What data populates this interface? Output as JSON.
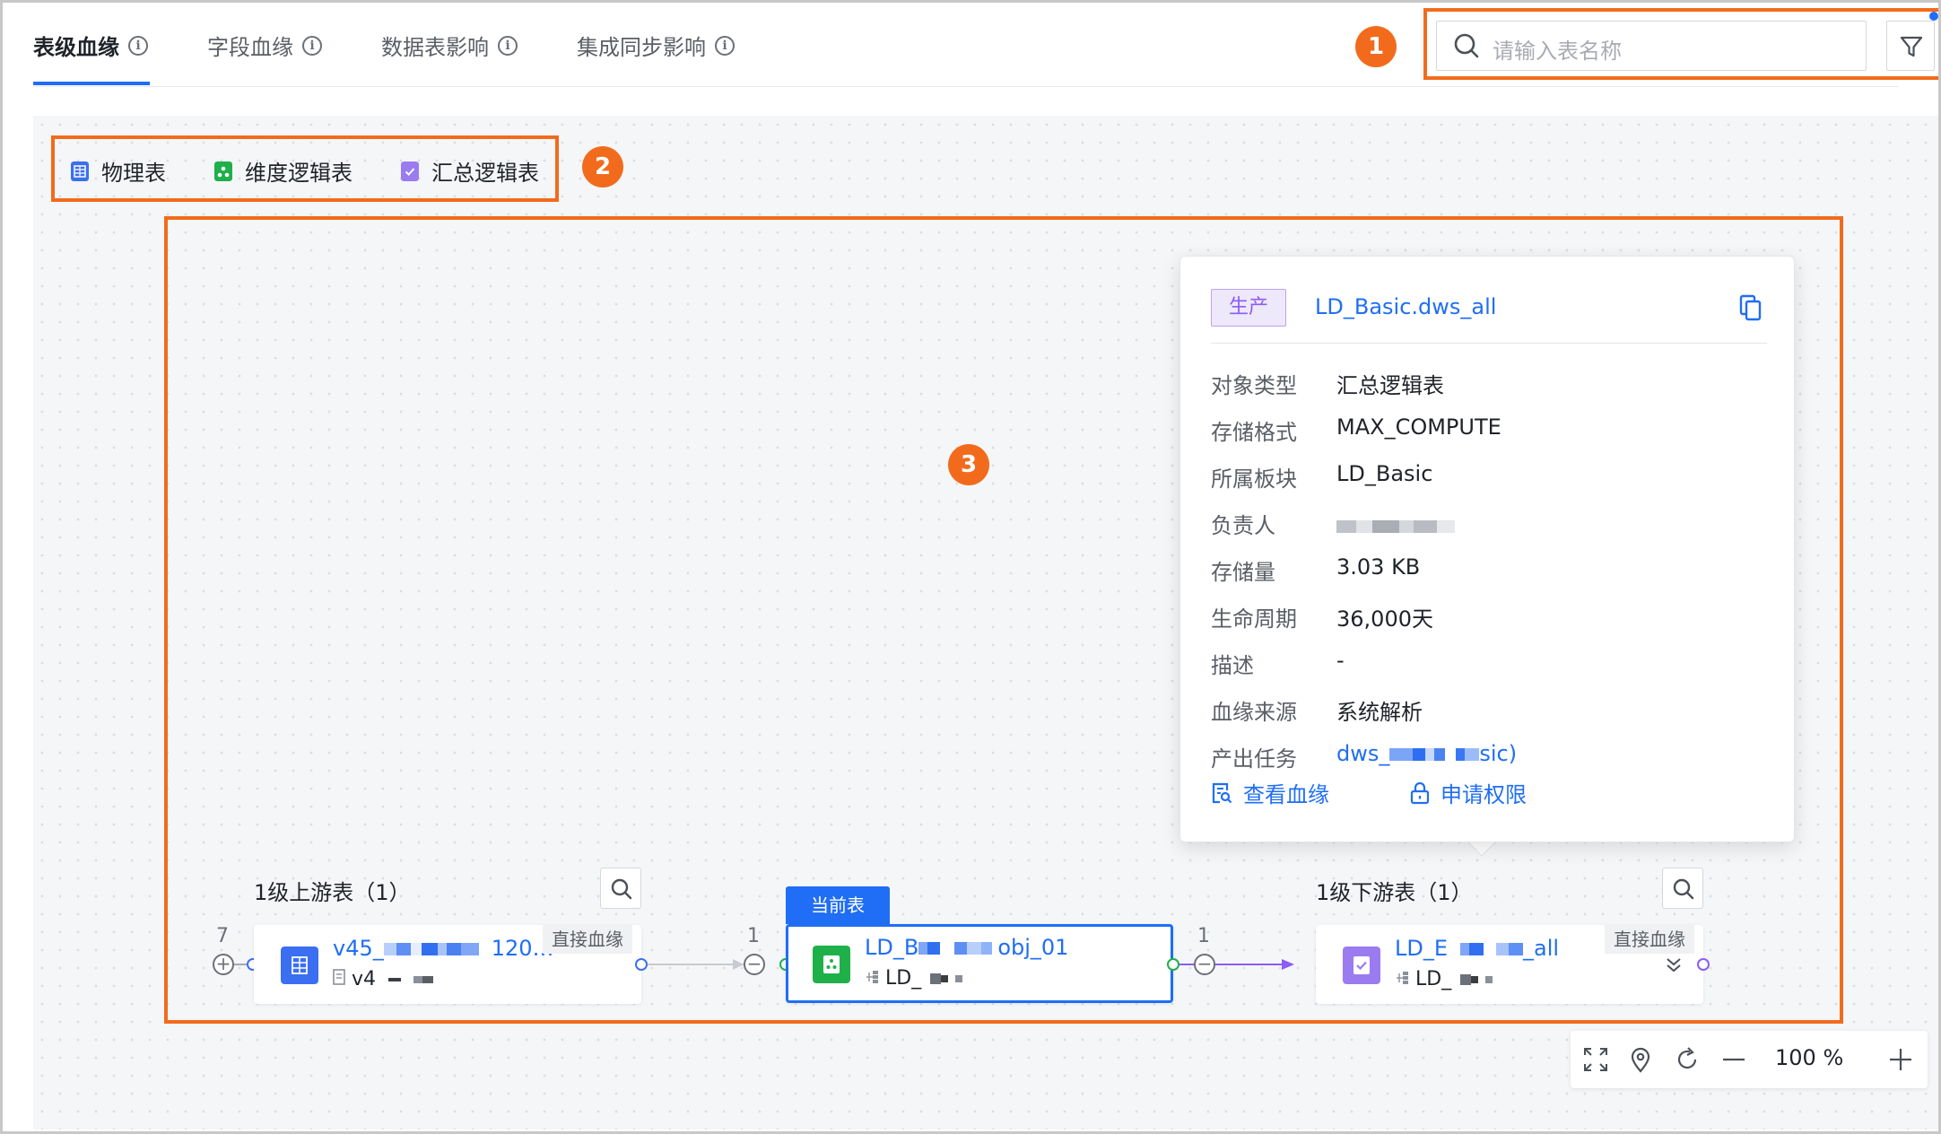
{
  "tabs": [
    {
      "label": "表级血缘",
      "active": true
    },
    {
      "label": "字段血缘",
      "active": false
    },
    {
      "label": "数据表影响",
      "active": false
    },
    {
      "label": "集成同步影响",
      "active": false
    }
  ],
  "search": {
    "placeholder": "请输入表名称"
  },
  "callouts": [
    "1",
    "2",
    "3"
  ],
  "legend": [
    {
      "label": "物理表",
      "icon": "table-icon",
      "color": "#3b6ff2"
    },
    {
      "label": "维度逻辑表",
      "icon": "dimension-table-icon",
      "color": "#1fb04a"
    },
    {
      "label": "汇总逻辑表",
      "icon": "summary-table-icon",
      "color": "#9b7bf0"
    }
  ],
  "popover": {
    "env_tag": "生产",
    "title": "LD_Basic.dws_all",
    "rows": [
      {
        "label": "对象类型",
        "value": "汇总逻辑表"
      },
      {
        "label": "存储格式",
        "value": "MAX_COMPUTE"
      },
      {
        "label": "所属板块",
        "value": "LD_Basic"
      },
      {
        "label": "负责人",
        "value": ""
      },
      {
        "label": "存储量",
        "value": "3.03 KB"
      },
      {
        "label": "生命周期",
        "value": "36,000天"
      },
      {
        "label": "描述",
        "value": "-"
      },
      {
        "label": "血缘来源",
        "value": "系统解析"
      },
      {
        "label": "产出任务",
        "value_prefix": "dws_",
        "value_suffix": "sic)"
      }
    ],
    "actions": {
      "view_lineage": "查看血缘",
      "request_permission": "申请权限"
    }
  },
  "graph": {
    "upstream": {
      "title": "1级上游表（1）",
      "expand_count": "7",
      "node": {
        "title_prefix": "v45_",
        "title_suffix": "120…",
        "sub_prefix": "v4",
        "tag": "直接血缘"
      }
    },
    "current": {
      "tag": "当前表",
      "in_count": "1",
      "node": {
        "title_prefix": "LD_B",
        "title_suffix": "obj_01",
        "sub_prefix": "LD_"
      }
    },
    "downstream": {
      "title": "1级下游表（1）",
      "in_count": "1",
      "node": {
        "title_prefix": "LD_E",
        "title_suffix": "_all",
        "sub_prefix": "LD_",
        "tag": "直接血缘"
      }
    }
  },
  "zoom": {
    "value": "100",
    "unit": "%"
  }
}
